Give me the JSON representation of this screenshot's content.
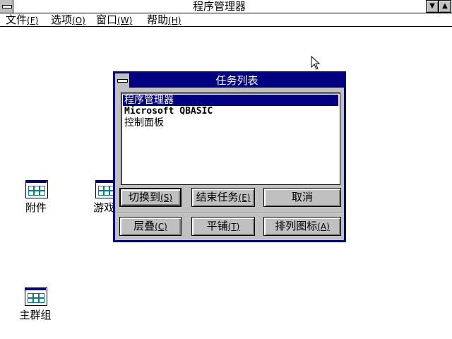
{
  "window": {
    "title": "程序管理器",
    "minimize_glyph": "▼",
    "maximize_glyph": "▲"
  },
  "menubar": {
    "items": [
      {
        "label": "文件",
        "accel": "(F)"
      },
      {
        "label": "选项",
        "accel": "(O)"
      },
      {
        "label": "窗口",
        "accel": "(W)"
      },
      {
        "label": "帮助",
        "accel": "(H)"
      }
    ]
  },
  "desktop": {
    "icons": [
      {
        "label": "附件"
      },
      {
        "label": "游戏"
      },
      {
        "label": "主群组"
      }
    ]
  },
  "task_list_dialog": {
    "title": "任务列表",
    "tasks": [
      {
        "label": "程序管理器",
        "selected": true
      },
      {
        "label": "Microsoft QBASIC",
        "selected": false
      },
      {
        "label": "控制面板",
        "selected": false
      }
    ],
    "buttons_row1": [
      {
        "label": "切换到",
        "accel": "(S)"
      },
      {
        "label": "结束任务",
        "accel": "(E)"
      },
      {
        "label": "取消",
        "accel": ""
      }
    ],
    "buttons_row2": [
      {
        "label": "层叠",
        "accel": "(C)"
      },
      {
        "label": "平铺",
        "accel": "(T)"
      },
      {
        "label": "排列图标",
        "accel": "(A)"
      }
    ]
  }
}
